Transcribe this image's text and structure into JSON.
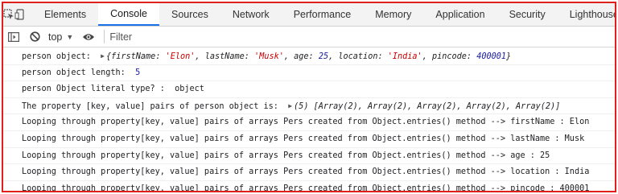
{
  "tabs": [
    "Elements",
    "Console",
    "Sources",
    "Network",
    "Performance",
    "Memory",
    "Application",
    "Security",
    "Lighthouse"
  ],
  "active_tab": "Console",
  "toolbar": {
    "context": "top",
    "filter_placeholder": "Filter"
  },
  "console": {
    "line1_label": "person object:  ",
    "line1_obj": {
      "k1": "firstName",
      "v1": "'Elon'",
      "k2": "lastName",
      "v2": "'Musk'",
      "k3": "age",
      "v3": "25",
      "k4": "location",
      "v4": "'India'",
      "k5": "pincode",
      "v5": "400001"
    },
    "line2_label": "person object length:  ",
    "line2_value": "5",
    "line3_text": "person Object literal type? :  object",
    "line4_label": "The property [key, value] pairs of person object is:  ",
    "line4_value": "(5) [Array(2), Array(2), Array(2), Array(2), Array(2)]",
    "loop_lines": [
      "Looping through property[key, value] pairs of arrays Pers created from Object.entries() method --> firstName : Elon",
      "Looping through property[key, value] pairs of arrays Pers created from Object.entries() method --> lastName : Musk",
      "Looping through property[key, value] pairs of arrays Pers created from Object.entries() method --> age : 25",
      "Looping through property[key, value] pairs of arrays Pers created from Object.entries() method --> location : India",
      "Looping through property[key, value] pairs of arrays Pers created from Object.entries() method --> pincode : 400001"
    ],
    "colors": {
      "string": "#c80000",
      "number": "#1a1aa6",
      "accent": "#1a73e8",
      "frame": "#e0201b"
    }
  }
}
